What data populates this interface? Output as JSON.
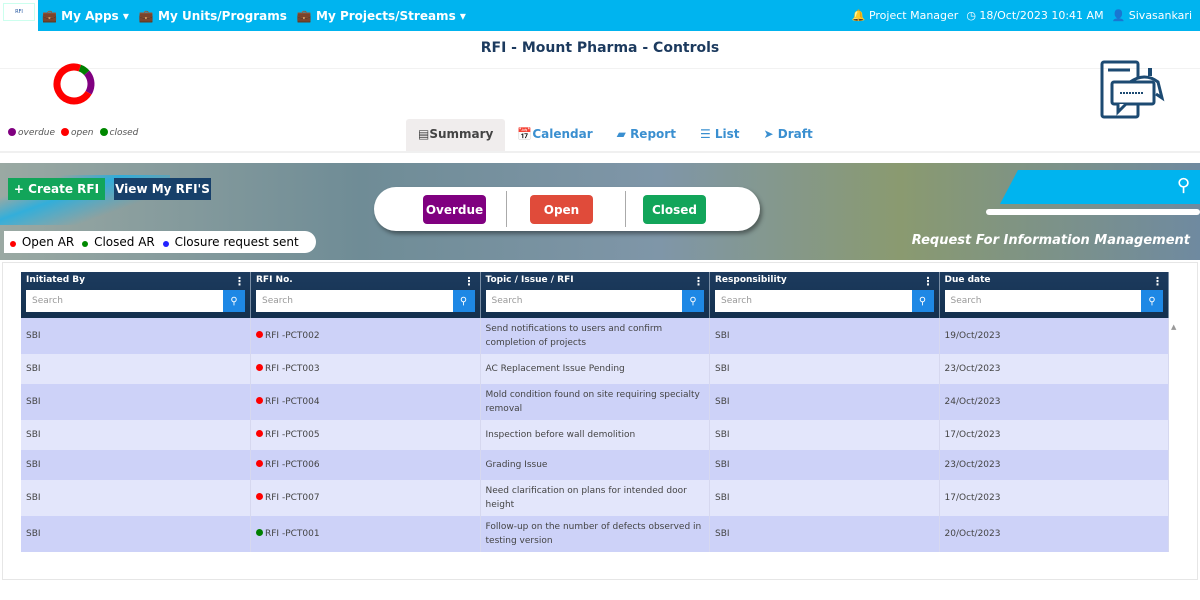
{
  "topbar": {
    "logo_text": "RFI",
    "nav": [
      "My Apps",
      "My Units/Programs",
      "My Projects/Streams"
    ],
    "role": "Project Manager",
    "datetime": "18/Oct/2023 10:41 AM",
    "user": "Sivasankari"
  },
  "page_title": "RFI - Mount Pharma - Controls",
  "donut": {
    "overdue": 0.2,
    "open": 0.72,
    "closed": 0.08
  },
  "legend": [
    "overdue",
    "open",
    "closed"
  ],
  "colors": {
    "overdue": "#800080",
    "open": "#ff0000",
    "closed": "#008000",
    "accent": "#00b4ef"
  },
  "tabs": [
    "Summary",
    "Calendar",
    "Report",
    "List",
    "Draft"
  ],
  "banner": {
    "create": "+ Create RFI",
    "view": "View My RFI'S",
    "ar_legend": [
      "Open AR",
      "Closed AR",
      "Closure request sent"
    ],
    "status_buttons": [
      "Overdue",
      "Open",
      "Closed"
    ],
    "subtitle": "Request For Information Management"
  },
  "table": {
    "columns": [
      "Initiated By",
      "RFI No.",
      "Topic / Issue / RFI",
      "Responsibility",
      "Due date"
    ],
    "search_placeholder": "Search",
    "rows": [
      {
        "initiated": "SBI",
        "status": "open",
        "rfi": "RFI -PCT002",
        "topic": "Send notifications to users and confirm completion of projects",
        "resp": "SBI",
        "due": "19/Oct/2023"
      },
      {
        "initiated": "SBI",
        "status": "open",
        "rfi": "RFI -PCT003",
        "topic": "AC Replacement Issue Pending",
        "resp": "SBI",
        "due": "23/Oct/2023"
      },
      {
        "initiated": "SBI",
        "status": "open",
        "rfi": "RFI -PCT004",
        "topic": "Mold condition found on site requiring specialty removal",
        "resp": "SBI",
        "due": "24/Oct/2023"
      },
      {
        "initiated": "SBI",
        "status": "open",
        "rfi": "RFI -PCT005",
        "topic": "Inspection before wall demolition",
        "resp": "SBI",
        "due": "17/Oct/2023"
      },
      {
        "initiated": "SBI",
        "status": "open",
        "rfi": "RFI -PCT006",
        "topic": "Grading Issue",
        "resp": "SBI",
        "due": "23/Oct/2023"
      },
      {
        "initiated": "SBI",
        "status": "open",
        "rfi": "RFI -PCT007",
        "topic": "Need clarification on plans for intended door height",
        "resp": "SBI",
        "due": "17/Oct/2023"
      },
      {
        "initiated": "SBI",
        "status": "closed",
        "rfi": "RFI -PCT001",
        "topic": "Follow-up on the number of defects observed in testing version",
        "resp": "SBI",
        "due": "20/Oct/2023"
      }
    ]
  }
}
